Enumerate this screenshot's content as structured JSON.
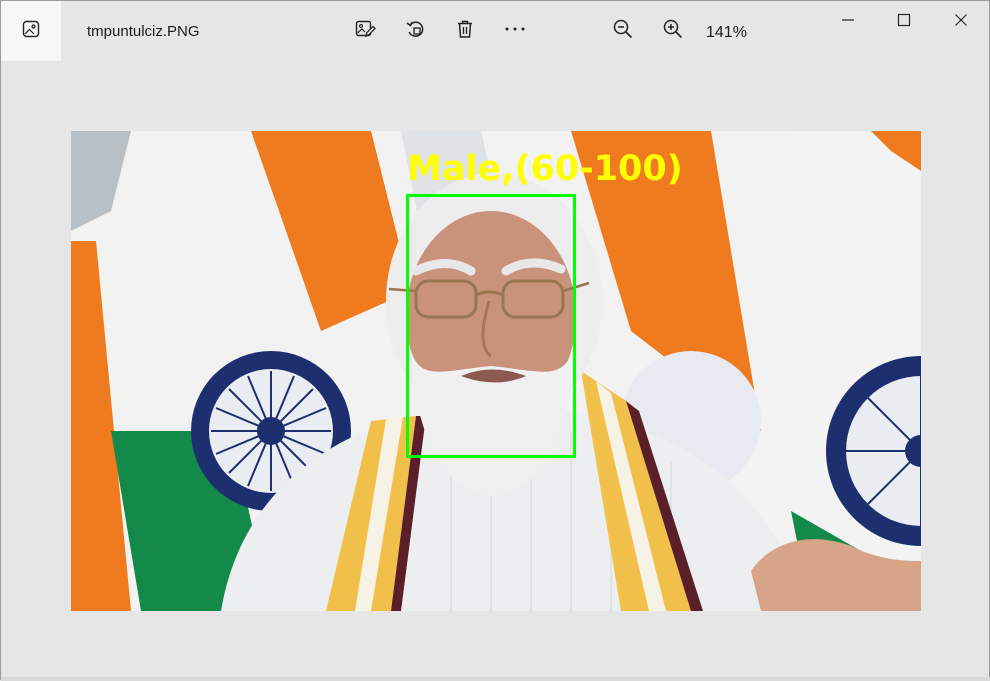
{
  "titlebar": {
    "file_name": "tmpuntulciz.PNG",
    "zoom_level": "141%"
  },
  "toolbar": {
    "icons": [
      "edit-image-icon",
      "rotate-icon",
      "delete-icon",
      "more-icon",
      "zoom-out-icon",
      "zoom-in-icon"
    ]
  },
  "window_controls": [
    "minimize-icon",
    "maximize-icon",
    "close-icon"
  ],
  "photo": {
    "detection_label": "Male,(60-100)",
    "box_color": "#00ff00",
    "label_color": "#ffff00"
  },
  "colors": {
    "background": "#e6e6e6",
    "saffron": "#f07a1e",
    "green": "#138a4a",
    "chakra_navy": "#0e1d5c"
  }
}
